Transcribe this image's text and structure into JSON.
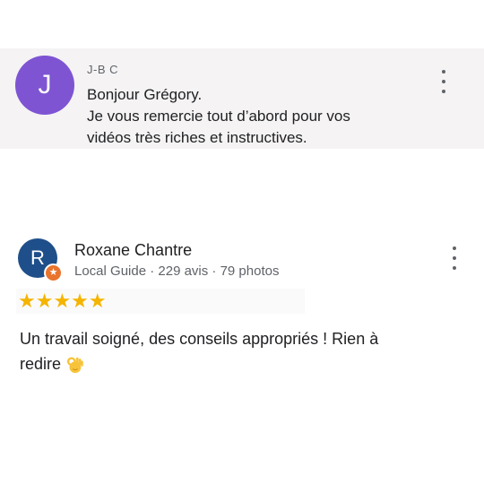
{
  "comment": {
    "avatar_initial": "J",
    "author": "J-B C",
    "lines": [
      "Bonjour Grégory.",
      "Je vous remercie tout d’abord pour vos",
      "vidéos très riches et instructives."
    ],
    "menu_icon": "more-vert-icon"
  },
  "review": {
    "avatar_initial": "R",
    "badge_icon": "local-guide-star-icon",
    "name": "Roxane Chantre",
    "meta": "Local Guide · 229 avis · 79 photos",
    "rating": 5,
    "stars": "★★★★★",
    "text_line1": "Un travail soigné, des conseils appropriés ! Rien à",
    "text_line2": "redire",
    "emoji_icon": "ok-hand-emoji",
    "menu_icon": "more-vert-icon"
  },
  "colors": {
    "avatar_jbc": "#7e54d3",
    "avatar_rc": "#1f4f8a",
    "badge": "#e9742d",
    "stars": "#f5b400",
    "card_bg": "#f5f3f4"
  }
}
